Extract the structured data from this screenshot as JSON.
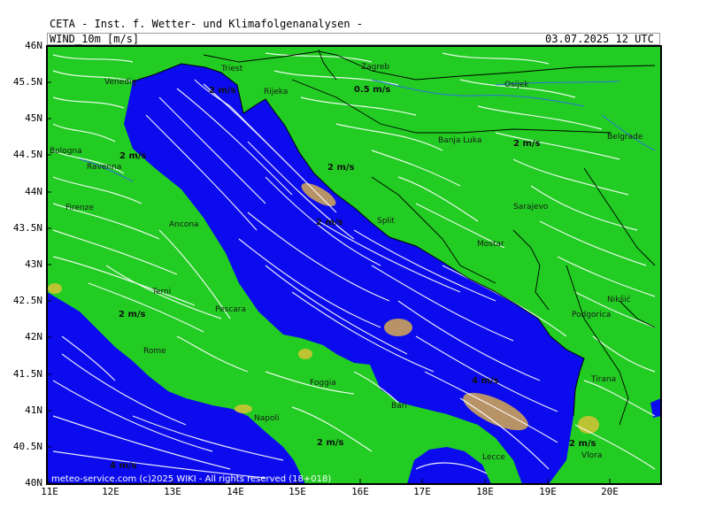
{
  "header": {
    "source": "CETA - Inst. f. Wetter- und Klimafolgenanalysen -",
    "variable": "WIND_10m [m/s]",
    "valid_time": "03.07.2025 12 UTC"
  },
  "axes": {
    "lat_labels": [
      "46N",
      "45.5N",
      "45N",
      "44.5N",
      "44N",
      "43.5N",
      "43N",
      "42.5N",
      "42N",
      "41.5N",
      "41N",
      "40.5N",
      "40N"
    ],
    "lon_labels": [
      "11E",
      "12E",
      "13E",
      "14E",
      "15E",
      "16E",
      "17E",
      "18E",
      "19E",
      "20E"
    ]
  },
  "colors": {
    "land": "#22cc22",
    "sea": "#0b0bee",
    "streamline": "#ffffff",
    "high_wind": "#f2c23a",
    "border": "#000000",
    "river": "#3070e0"
  },
  "cities": [
    {
      "name": "Venedig"
    },
    {
      "name": "Triest"
    },
    {
      "name": "Rijeka"
    },
    {
      "name": "Zagreb"
    },
    {
      "name": "Osijek"
    },
    {
      "name": "Bologna"
    },
    {
      "name": "Ravenna"
    },
    {
      "name": "Banja Luka"
    },
    {
      "name": "Belgrade"
    },
    {
      "name": "Firenze"
    },
    {
      "name": "Ancona"
    },
    {
      "name": "Split"
    },
    {
      "name": "Sarajevo"
    },
    {
      "name": "Mostar"
    },
    {
      "name": "Terni"
    },
    {
      "name": "Pescara"
    },
    {
      "name": "Nikšić"
    },
    {
      "name": "Podgorica"
    },
    {
      "name": "Rome"
    },
    {
      "name": "Foggia"
    },
    {
      "name": "Bari"
    },
    {
      "name": "Tirana"
    },
    {
      "name": "Napoli"
    },
    {
      "name": "Lecce"
    },
    {
      "name": "Vlora"
    }
  ],
  "wind_labels": [
    {
      "text": "2 m/s"
    },
    {
      "text": "0.5 m/s"
    },
    {
      "text": "2 m/s"
    },
    {
      "text": "2 m/s"
    },
    {
      "text": "2 m/s"
    },
    {
      "text": "2 m/s"
    },
    {
      "text": "2 m/s"
    },
    {
      "text": "4 m/s"
    },
    {
      "text": "2 m/s"
    },
    {
      "text": "2 m/s"
    },
    {
      "text": "4 m/s"
    }
  ],
  "copyright": "meteo-service.com (c)2025 WIKI - All rights reserved (18+018)"
}
